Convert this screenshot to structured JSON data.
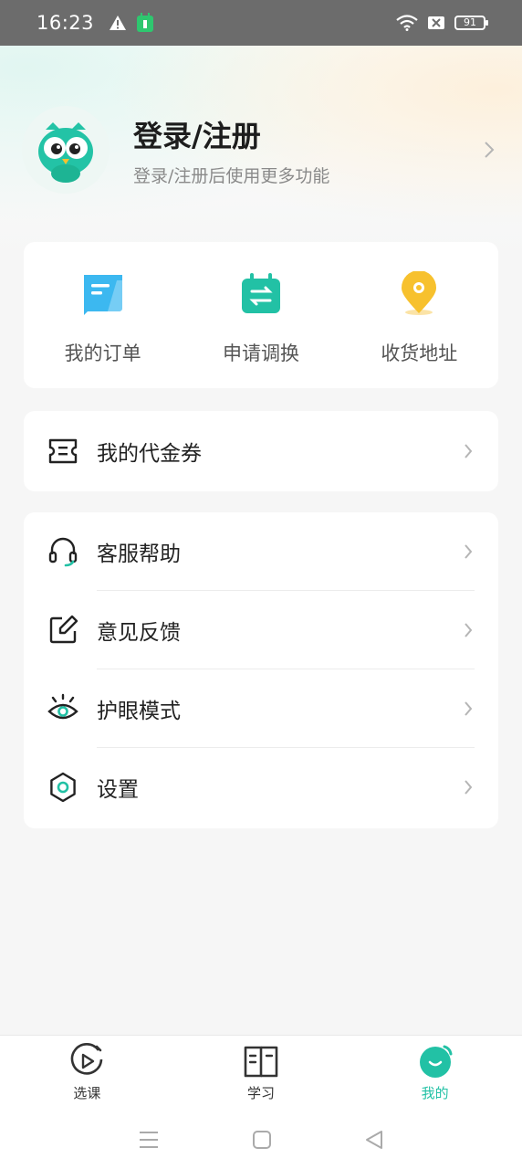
{
  "status_bar": {
    "time": "16:23",
    "battery": "91"
  },
  "profile": {
    "title": "登录/注册",
    "subtitle": "登录/注册后使用更多功能"
  },
  "quick_actions": [
    {
      "label": "我的订单",
      "icon": "order-icon"
    },
    {
      "label": "申请调换",
      "icon": "exchange-icon"
    },
    {
      "label": "收货地址",
      "icon": "location-pin-icon"
    }
  ],
  "coupon": {
    "label": "我的代金券",
    "icon": "ticket-icon"
  },
  "menu": [
    {
      "label": "客服帮助",
      "icon": "headset-icon"
    },
    {
      "label": "意见反馈",
      "icon": "edit-icon"
    },
    {
      "label": "护眼模式",
      "icon": "eye-icon"
    },
    {
      "label": "设置",
      "icon": "gear-icon"
    }
  ],
  "tabs": [
    {
      "label": "选课",
      "icon": "play-circle-icon",
      "active": false
    },
    {
      "label": "学习",
      "icon": "book-icon",
      "active": false
    },
    {
      "label": "我的",
      "icon": "profile-face-icon",
      "active": true
    }
  ],
  "colors": {
    "accent": "#22c1a5",
    "order_blue": "#3cb8f0",
    "pin_yellow": "#f7c12e"
  }
}
